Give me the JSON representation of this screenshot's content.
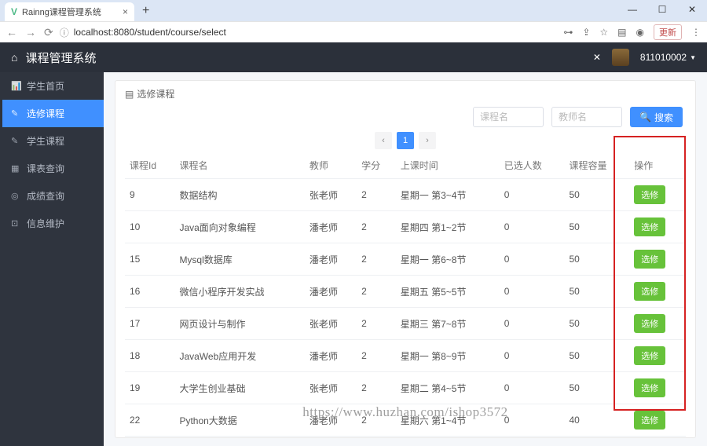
{
  "browser": {
    "tab_title": "Rainng课程管理系统",
    "new_tab": "+",
    "tab_close": "×",
    "win_min": "—",
    "win_max": "☐",
    "win_close": "✕",
    "nav_back": "←",
    "nav_fwd": "→",
    "nav_reload": "⟳",
    "addr_lock": "ⓘ",
    "url": "localhost:8080/student/course/select",
    "key_icon": "⊶",
    "share_icon": "⇪",
    "ext_icon": "☆",
    "puzzle_icon": "▤",
    "profile_icon": "◉",
    "update_btn": "更新",
    "menu_icon": "⋮"
  },
  "header": {
    "home_icon": "⌂",
    "title": "课程管理系统",
    "expand_icon": "✕",
    "user_id": "811010002",
    "caret": "▼"
  },
  "sidebar": {
    "items": [
      {
        "icon": "📊",
        "label": "学生首页"
      },
      {
        "icon": "✎",
        "label": "选修课程"
      },
      {
        "icon": "✎",
        "label": "学生课程"
      },
      {
        "icon": "▦",
        "label": "课表查询"
      },
      {
        "icon": "◎",
        "label": "成绩查询"
      },
      {
        "icon": "⊡",
        "label": "信息维护"
      }
    ]
  },
  "crumb": {
    "icon": "▤",
    "text": "选修课程"
  },
  "search": {
    "course_placeholder": "课程名",
    "teacher_placeholder": "教师名",
    "btn_icon": "🔍",
    "btn_label": "搜索"
  },
  "pager": {
    "prev": "‹",
    "page": "1",
    "next": "›"
  },
  "table": {
    "headers": {
      "id": "课程Id",
      "name": "课程名",
      "teacher": "教师",
      "credit": "学分",
      "time": "上课时间",
      "selected": "已选人数",
      "capacity": "课程容量",
      "op": "操作"
    },
    "rows": [
      {
        "id": "9",
        "name": "数据结构",
        "teacher": "张老师",
        "credit": "2",
        "time": "星期一 第3~4节",
        "selected": "0",
        "capacity": "50"
      },
      {
        "id": "10",
        "name": "Java面向对象编程",
        "teacher": "潘老师",
        "credit": "2",
        "time": "星期四 第1~2节",
        "selected": "0",
        "capacity": "50"
      },
      {
        "id": "15",
        "name": "Mysql数据库",
        "teacher": "潘老师",
        "credit": "2",
        "time": "星期一 第6~8节",
        "selected": "0",
        "capacity": "50"
      },
      {
        "id": "16",
        "name": "微信小程序开发实战",
        "teacher": "潘老师",
        "credit": "2",
        "time": "星期五 第5~5节",
        "selected": "0",
        "capacity": "50"
      },
      {
        "id": "17",
        "name": "网页设计与制作",
        "teacher": "张老师",
        "credit": "2",
        "time": "星期三 第7~8节",
        "selected": "0",
        "capacity": "50"
      },
      {
        "id": "18",
        "name": "JavaWeb应用开发",
        "teacher": "潘老师",
        "credit": "2",
        "time": "星期一 第8~9节",
        "selected": "0",
        "capacity": "50"
      },
      {
        "id": "19",
        "name": "大学生创业基础",
        "teacher": "张老师",
        "credit": "2",
        "time": "星期二 第4~5节",
        "selected": "0",
        "capacity": "50"
      },
      {
        "id": "22",
        "name": "Python大数据",
        "teacher": "潘老师",
        "credit": "2",
        "time": "星期六 第1~4节",
        "selected": "0",
        "capacity": "40"
      }
    ],
    "select_label": "选修"
  },
  "watermark": "https://www.huzhan.com/ishop3572"
}
